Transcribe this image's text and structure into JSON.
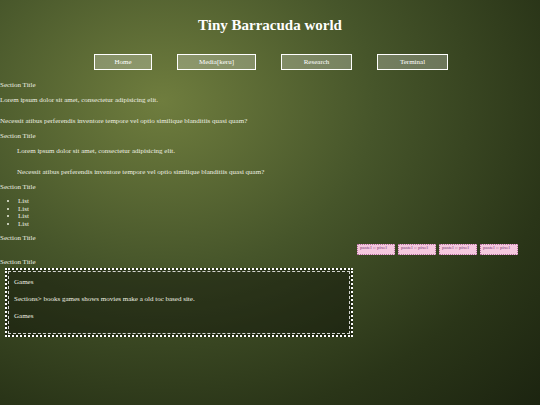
{
  "header": {
    "title": "Tiny Barracuda world"
  },
  "nav": [
    {
      "label": "Home"
    },
    {
      "label": "Media[keru]"
    },
    {
      "label": "Research"
    },
    {
      "label": "Terminal"
    }
  ],
  "sections": [
    {
      "title": "Section Title",
      "kind": "paragraphs",
      "items": [
        "Lorem ipsum dolor sit amet, consectetur adipisicing elit.",
        "Necessit atibus perferendis inventore tempore vel optio similique blanditiis quasi quam?"
      ]
    },
    {
      "title": "Section Title",
      "kind": "indented",
      "items": [
        "Lorem ipsum dolor sit amet, consectetur adipisicing elit.",
        "Necessit atibus perferendis inventore tempore vel optio similique blanditiis quasi quam?"
      ]
    },
    {
      "title": "Section Title",
      "kind": "list",
      "items": [
        "List",
        "List",
        "List",
        "List"
      ]
    },
    {
      "title": "Section Title",
      "kind": "badges",
      "items": [
        "pastel :: pixel",
        "pastel :: pixel",
        "pastel :: pixel",
        "pastel :: pixel"
      ]
    },
    {
      "title": "Section Title",
      "kind": "box",
      "items": [
        "Games",
        "Sections> books games shows movies make a old toc based site.",
        "Games"
      ]
    }
  ]
}
